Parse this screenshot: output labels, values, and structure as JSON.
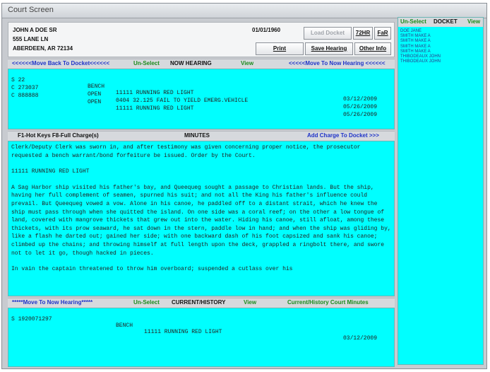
{
  "window": {
    "title": "Court Screen"
  },
  "defendant": {
    "name": "JOHN A DOE SR",
    "street": "555 LANE LN",
    "city": "ABERDEEN, AR 72134",
    "date": "01/01/1960"
  },
  "buttons": {
    "load_docket": "Load Docket",
    "72hr": "72HR",
    "fail": "FaR",
    "print": "Print",
    "save_hearing": "Save Hearing",
    "other_info": "Other Info"
  },
  "now_hearing_bar": {
    "move_back": "<<<<<<Move Back To Docket<<<<<<",
    "unselect": "Un-Select",
    "title": "NOW HEARING",
    "view": "View",
    "move_to": "<<<<<Move To Now Hearing <<<<<<"
  },
  "now_hearing_rows": [
    {
      "col1": "S 22",
      "status": "BENCH",
      "desc": "11111 RUNNING RED LIGHT",
      "date": "03/12/2009"
    },
    {
      "col1": "C 273037",
      "status": "OPEN",
      "desc": "0404 32.125 FAIL TO YIELD EMERG.VEHICLE",
      "date": "05/26/2009"
    },
    {
      "col1": "C 888888",
      "status": "OPEN",
      "desc": "11111 RUNNING RED LIGHT",
      "date": "05/26/2009"
    }
  ],
  "minutes_bar": {
    "hot_keys": "F1-Hot Keys  F8-Full Charge(s)",
    "title": "MINUTES",
    "add_charge": "Add Charge To Docket >>>"
  },
  "minutes": {
    "p1": "Clerk/Deputy Clerk was sworn in, and after testimony was given concerning proper notice, the prosecutor requested a bench warrant/bond forfeiture be issued. Order by the Court.",
    "p2": "11111 RUNNING RED LIGHT",
    "p3": "A Sag Harbor ship visited his father's bay, and Queequeg sought a passage to Christian lands. But the ship, having her full complement of seamen, spurned his suit; and not all the King his father's influence could prevail. But Queequeg vowed a vow. Alone in his canoe, he paddled off to a distant strait, which he knew the ship must pass through when she quitted the island. On one side was a coral reef; on the other a low tongue of land, covered with mangrove thickets that grew out into the water. Hiding his canoe, still afloat, among these thickets, with its prow seaward, he sat down in the stern, paddle low in hand; and when the ship was gliding by, like a flash he darted out; gained her side; with one backward dash of his foot capsized and sank his canoe; climbed up the chains; and throwing himself at full length upon the deck, grappled a ringbolt there, and swore not to let it go, though hacked in pieces.",
    "p4": "In vain the captain threatened to throw him overboard; suspended a cutlass over his"
  },
  "history_bar": {
    "move_to": "*****Move To Now Hearing*****",
    "unselect": "Un-Select",
    "title": "CURRENT/HISTORY",
    "view": "View",
    "minutes_label": "Current/History Court Minutes"
  },
  "history_rows": [
    {
      "col1": "S 1920071297",
      "status": "BENCH",
      "desc": "11111 RUNNING RED LIGHT",
      "date": "03/12/2009"
    }
  ],
  "docket": {
    "unselect": "Un-Select",
    "title": "DOCKET",
    "view": "View",
    "names": [
      "DOE JANE",
      "SMITH MAKE A",
      "SMITH MAKE A",
      "SMITH MAKE A",
      "SMITH MAKE A",
      "THIBODEAUX JOHN",
      "THIBODEAUX JOHN"
    ]
  }
}
